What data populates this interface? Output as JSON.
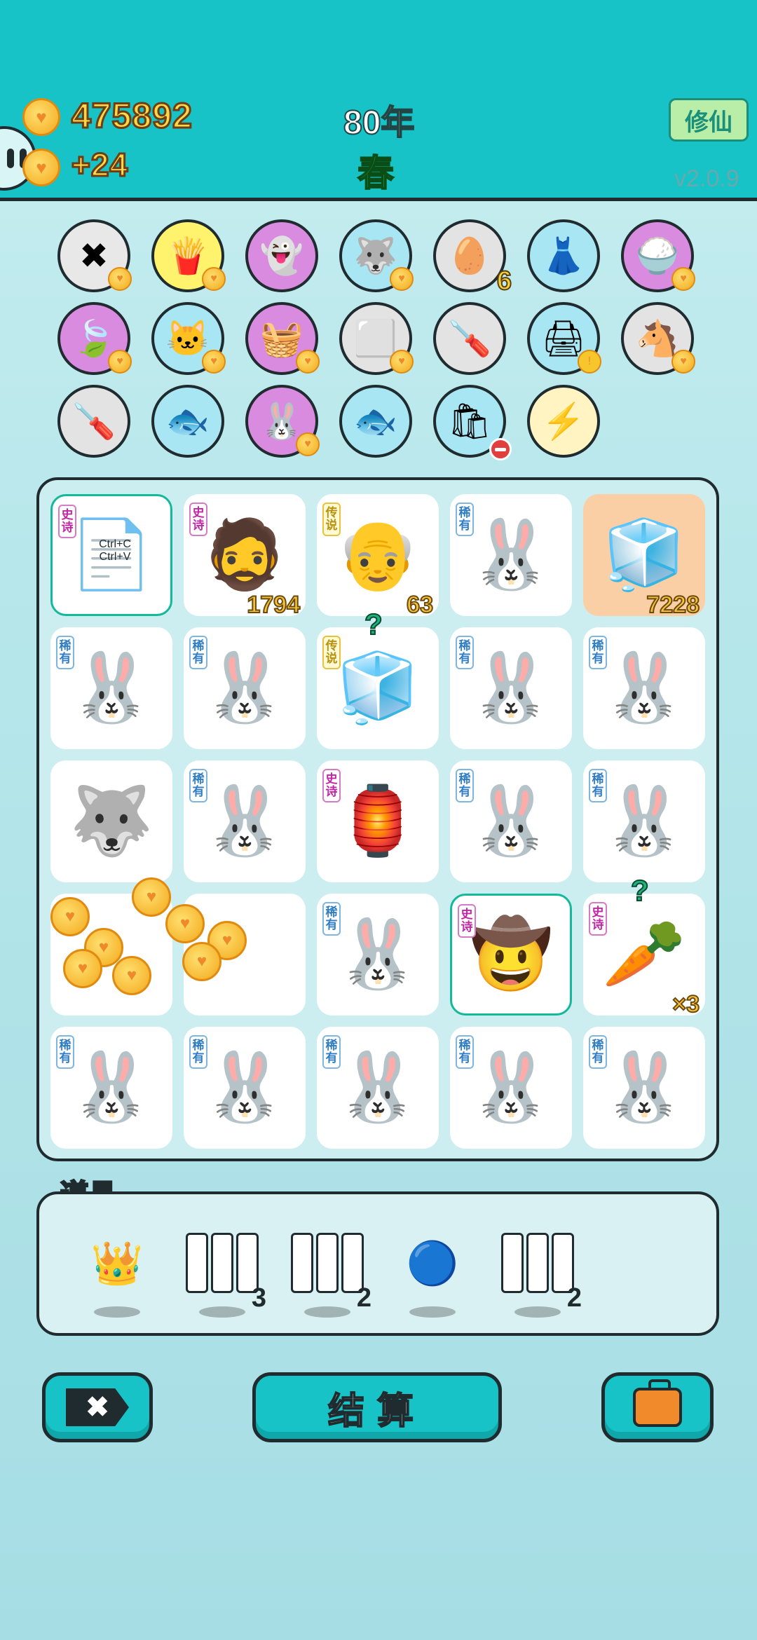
{
  "header": {
    "coins": "475892",
    "income": "+24",
    "year": "80年",
    "season": "春",
    "mode_button": "修仙",
    "version": "v2.0.9"
  },
  "inventory": [
    {
      "name": "remove-icon",
      "glyph": "✖",
      "bg": "#e8e8e8",
      "heart": true
    },
    {
      "name": "fries-icon",
      "glyph": "🍟",
      "bg": "#fff36e",
      "heart": true
    },
    {
      "name": "ghost-icon",
      "glyph": "👻",
      "bg": "#d98be0",
      "heart": false
    },
    {
      "name": "husky-icon",
      "glyph": "🐺",
      "bg": "#a7e6f2",
      "heart": true
    },
    {
      "name": "egg-tray-icon",
      "glyph": "🥚",
      "bg": "#e3e3e3",
      "count": "6"
    },
    {
      "name": "skirt-icon",
      "glyph": "👗",
      "bg": "#a7e6f2",
      "heart": false
    },
    {
      "name": "rice-bowl-icon",
      "glyph": "🍚",
      "bg": "#d98be0",
      "heart": true
    },
    {
      "name": "leaf-icon",
      "glyph": "🍃",
      "bg": "#d98be0",
      "heart": true
    },
    {
      "name": "cat-icon",
      "glyph": "🐱",
      "bg": "#a7e6f2",
      "heart": true
    },
    {
      "name": "fruit-basket-icon",
      "glyph": "🧺",
      "bg": "#d98be0",
      "heart": true
    },
    {
      "name": "sugar-cubes-icon",
      "glyph": "⬜",
      "bg": "#e3e3e3",
      "heart": true
    },
    {
      "name": "screwdriver-icon",
      "glyph": "🪛",
      "bg": "#e3e3e3",
      "heart": false
    },
    {
      "name": "printer-icon",
      "glyph": "🖨",
      "bg": "#a7e6f2",
      "warn": true
    },
    {
      "name": "dolls-icon",
      "glyph": "🐴",
      "bg": "#e3e3e3",
      "heart": true
    },
    {
      "name": "screwdriver-icon",
      "glyph": "🪛",
      "bg": "#e3e3e3",
      "heart": false
    },
    {
      "name": "fishbowl-icon",
      "glyph": "🐟",
      "bg": "#a7e6f2",
      "heart": false
    },
    {
      "name": "rabbit-icon",
      "glyph": "🐰",
      "bg": "#d98be0",
      "heart": true
    },
    {
      "name": "fishbowl-icon",
      "glyph": "🐟",
      "bg": "#a7e6f2",
      "heart": false
    },
    {
      "name": "trash-bag-icon",
      "glyph": "🛍",
      "bg": "#a7e6f2",
      "block": true
    },
    {
      "name": "lightning-icon",
      "glyph": "⚡",
      "bg": "#fff4c2",
      "heart": false
    }
  ],
  "board": [
    {
      "name": "copy-paste-tile",
      "tag": "史诗",
      "tier": "epic",
      "glyph": "📄",
      "sub": "Ctrl+C Ctrl+V",
      "hl": true
    },
    {
      "name": "bearded-man-tile",
      "tag": "史诗",
      "tier": "epic",
      "glyph": "🧔",
      "num": "1794"
    },
    {
      "name": "grandpa-tile",
      "tag": "传说",
      "tier": "leg",
      "glyph": "👴",
      "num": "63"
    },
    {
      "name": "rabbit-tile",
      "tag": "稀有",
      "tier": "rare",
      "glyph": "🐰"
    },
    {
      "name": "fridge-tile",
      "glyph": "🧊",
      "num": "7228",
      "peach": true
    },
    {
      "name": "rabbit-tile",
      "tag": "稀有",
      "tier": "rare",
      "glyph": "🐰"
    },
    {
      "name": "rabbit-tile",
      "tag": "稀有",
      "tier": "rare",
      "glyph": "🐰"
    },
    {
      "name": "fridge-tile",
      "tag": "传说",
      "tier": "leg",
      "glyph": "🧊",
      "q": true
    },
    {
      "name": "rabbit-tile",
      "tag": "稀有",
      "tier": "rare",
      "glyph": "🐰"
    },
    {
      "name": "rabbit-tile",
      "tag": "稀有",
      "tier": "rare",
      "glyph": "🐰"
    },
    {
      "name": "husky-king-tile",
      "glyph": "🐺"
    },
    {
      "name": "rabbit-tile",
      "tag": "稀有",
      "tier": "rare",
      "glyph": "🐰"
    },
    {
      "name": "rabbit-house-tile",
      "tag": "史诗",
      "tier": "epic",
      "glyph": "🏮"
    },
    {
      "name": "rabbit-tile",
      "tag": "稀有",
      "tier": "rare",
      "glyph": "🐰"
    },
    {
      "name": "rabbit-tile",
      "tag": "稀有",
      "tier": "rare",
      "glyph": "🐰"
    },
    {
      "name": "empty-tile",
      "glyph": ""
    },
    {
      "name": "empty-tile",
      "glyph": ""
    },
    {
      "name": "rabbit-tile",
      "tag": "稀有",
      "tier": "rare",
      "glyph": "🐰"
    },
    {
      "name": "farmer-tile",
      "tag": "史诗",
      "tier": "epic",
      "glyph": "🤠",
      "hl": true
    },
    {
      "name": "carrot-tile",
      "tag": "史诗",
      "tier": "epic",
      "glyph": "🥕",
      "num": "×3",
      "q": true
    },
    {
      "name": "rabbit-tile",
      "tag": "稀有",
      "tier": "rare",
      "glyph": "🐰"
    },
    {
      "name": "rabbit-tile",
      "tag": "稀有",
      "tier": "rare",
      "glyph": "🐰"
    },
    {
      "name": "rabbit-tile",
      "tag": "稀有",
      "tier": "rare",
      "glyph": "🐰"
    },
    {
      "name": "rabbit-tile",
      "tag": "稀有",
      "tier": "rare",
      "glyph": "🐰"
    },
    {
      "name": "rabbit-tile",
      "tag": "稀有",
      "tier": "rare",
      "glyph": "🐰"
    }
  ],
  "tools": {
    "title": "道具",
    "items": [
      {
        "name": "crown-icon",
        "glyph": "👑",
        "count": ""
      },
      {
        "name": "rare-reroll-icon",
        "glyph": "slot",
        "count": "3"
      },
      {
        "name": "epic-reroll-icon",
        "glyph": "slot",
        "count": "2"
      },
      {
        "name": "blue-orb-icon",
        "glyph": "🔵",
        "count": ""
      },
      {
        "name": "blank-reroll-icon",
        "glyph": "slot",
        "count": "2"
      }
    ]
  },
  "buttons": {
    "settle": "结算"
  },
  "colors": {
    "header": "#17c3c6",
    "board_bg": "#cdeef0",
    "outline": "#1f2b2e"
  }
}
